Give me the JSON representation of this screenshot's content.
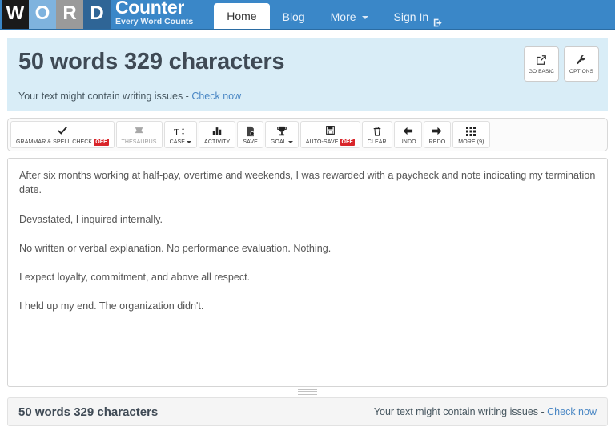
{
  "navbar": {
    "logo": {
      "letters": [
        "W",
        "O",
        "R",
        "D"
      ],
      "title": "Counter",
      "subtitle": "Every Word Counts",
      "colors": {
        "w": "#1a1a1a",
        "o": "#7fb3de",
        "r": "#9a9a9a",
        "d": "#2f6596",
        "bar": "#3a87c8"
      }
    },
    "items": [
      {
        "label": "Home",
        "active": true
      },
      {
        "label": "Blog",
        "active": false
      },
      {
        "label": "More",
        "active": false,
        "icon": "chevron-down-icon"
      },
      {
        "label": "Sign In",
        "active": false,
        "icon": "sign-in-icon"
      }
    ]
  },
  "header": {
    "headline": "50 words 329 characters",
    "notice_text": "Your text might contain writing issues -",
    "notice_link": "Check now",
    "background": "#d9edf7",
    "buttons": [
      {
        "label": "GO BASIC",
        "icon": "external-link-icon"
      },
      {
        "label": "OPTIONS",
        "icon": "wrench-icon"
      }
    ]
  },
  "toolbar": {
    "tools": [
      {
        "label": "GRAMMAR & SPELL CHECK",
        "icon": "check-icon",
        "badge": "OFF",
        "caret": false,
        "muted": false
      },
      {
        "label": "THESAURUS",
        "icon": "book-icon",
        "badge": "",
        "caret": false,
        "muted": true
      },
      {
        "label": "CASE",
        "icon": "text-case-icon",
        "badge": "",
        "caret": true,
        "muted": false
      },
      {
        "label": "ACTIVITY",
        "icon": "bar-chart-icon",
        "badge": "",
        "caret": false,
        "muted": false
      },
      {
        "label": "SAVE",
        "icon": "save-document-icon",
        "badge": "",
        "caret": false,
        "muted": false
      },
      {
        "label": "GOAL",
        "icon": "trophy-icon",
        "badge": "",
        "caret": true,
        "muted": false
      },
      {
        "label": "AUTO-SAVE",
        "icon": "floppy-disk-icon",
        "badge": "OFF",
        "caret": false,
        "muted": false
      },
      {
        "label": "CLEAR",
        "icon": "trash-icon",
        "badge": "",
        "caret": false,
        "muted": false
      },
      {
        "label": "UNDO",
        "icon": "arrow-left-icon",
        "badge": "",
        "caret": false,
        "muted": false
      },
      {
        "label": "REDO",
        "icon": "arrow-right-icon",
        "badge": "",
        "caret": false,
        "muted": false
      },
      {
        "label": "MORE (9)",
        "icon": "grid-icon",
        "badge": "",
        "caret": false,
        "muted": false
      }
    ],
    "badge_color": "#d9252a"
  },
  "editor": {
    "paragraphs": [
      "After six months working at half-pay, overtime and weekends, I was rewarded with a paycheck and note indicating my termination date.",
      "Devastated, I inquired internally.",
      "No written or verbal explanation. No performance evaluation. Nothing.",
      "I expect loyalty, commitment, and above all respect.",
      "I held up my end. The organization didn't."
    ]
  },
  "footer": {
    "counts": "50 words 329 characters",
    "notice_text": "Your text might contain writing issues -",
    "notice_link": "Check now"
  }
}
